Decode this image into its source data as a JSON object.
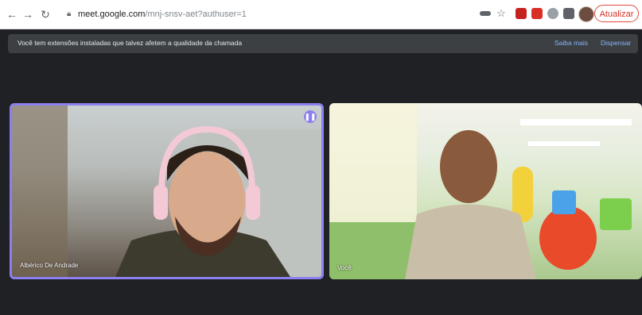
{
  "browser": {
    "url_host": "meet.google.com",
    "url_path": "/mnj-snsv-aet?authuser=1",
    "update_label": "Atualizar"
  },
  "banner": {
    "message": "Você tem extensões instaladas que talvez afetem a qualidade da chamada",
    "learn_more": "Saiba mais",
    "dismiss": "Dispensar"
  },
  "participants": [
    {
      "name": "Albérico De Andrade",
      "speaking": true
    },
    {
      "name": "Você",
      "speaking": false
    }
  ],
  "colors": {
    "accent": "#8c7ff0",
    "background": "#202124",
    "banner": "#3c4043",
    "link": "#8ab4f8"
  },
  "icons": {
    "back": "arrow-left-icon",
    "forward": "arrow-right-icon",
    "reload": "reload-icon",
    "lock": "lock-icon",
    "speaking": "audio-wave-icon"
  }
}
